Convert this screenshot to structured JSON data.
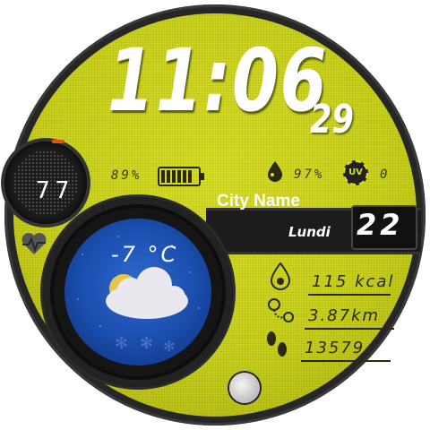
{
  "time": {
    "hours_minutes": "11:06",
    "seconds": "29"
  },
  "status": {
    "battery_percent": "89%",
    "battery_level": 0.89,
    "humidity_percent": "97%",
    "uv_label": "UV",
    "uv_value": "0"
  },
  "heart": {
    "rate": "77"
  },
  "location": {
    "city": "City Name",
    "day": "Lundi",
    "date": "22"
  },
  "weather": {
    "temperature": "-7 °C"
  },
  "fitness": {
    "calories": "115 kcal",
    "distance": "3.87km",
    "steps": "13579"
  },
  "colors": {
    "dial": "#d9df26",
    "bezel": "#262626",
    "weather_bg": "#1b4fb0",
    "text_light": "#ffffff",
    "text_dark": "#2a2a10",
    "hr_accent": "#e05020"
  },
  "icons": [
    "heart-rate-icon",
    "humidity-drop-icon",
    "uv-icon",
    "battery-icon",
    "calories-icon",
    "distance-icon",
    "steps-icon",
    "cloud-sun-snow-icon",
    "moon-phase-icon"
  ]
}
